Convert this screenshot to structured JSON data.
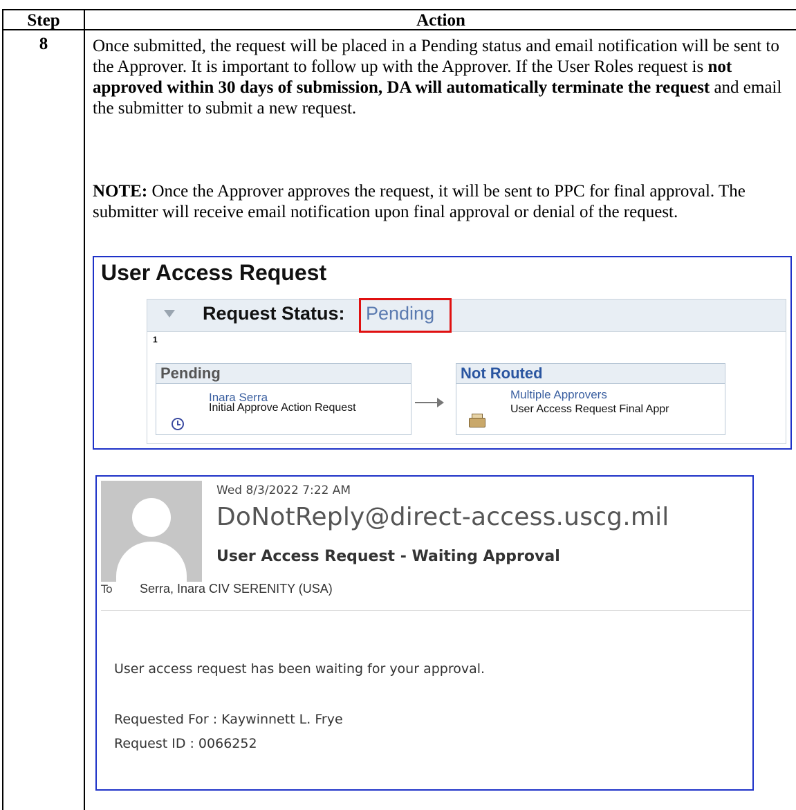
{
  "table": {
    "header_step": "Step",
    "header_action": "Action",
    "step_number": "8"
  },
  "instructions": {
    "p1_a": "Once submitted, the request will be placed in a Pending status and email notification will be sent to the Approver.  It is important to follow up with the Approver.  If the User Roles request is ",
    "p1_bold": "not approved within 30 days of submission, DA will automatically terminate the request",
    "p1_b": " and email the submitter to submit a new request.",
    "note_label": "NOTE:",
    "note_text": "  Once the Approver approves the request, it will be sent to PPC for final approval.  The submitter will receive email notification upon final approval or denial of the request."
  },
  "uar": {
    "title": "User Access Request",
    "status_label": "Request Status:",
    "status_value": "Pending",
    "step_index": "1",
    "stage1": {
      "header": "Pending",
      "name": "Inara Serra",
      "action": "Initial Approve Action Request",
      "icon": "clock-icon"
    },
    "stage2": {
      "header": "Not Routed",
      "name": "Multiple Approvers",
      "action": "User Access Request Final Appr",
      "icon": "inbox-tray-icon"
    },
    "highlight_color": "#e01010"
  },
  "email": {
    "date": "Wed 8/3/2022 7:22 AM",
    "from": "DoNotReply@direct-access.uscg.mil",
    "subject": "User Access Request - Waiting Approval",
    "to_label": "To",
    "to": "Serra, Inara CIV SERENITY (USA)",
    "body_line1": "User access request has been waiting for your approval.",
    "requested_for": "Requested For : Kaywinnett L. Frye",
    "request_id": "Request ID : 0066252",
    "border_color": "#1e32c8"
  }
}
